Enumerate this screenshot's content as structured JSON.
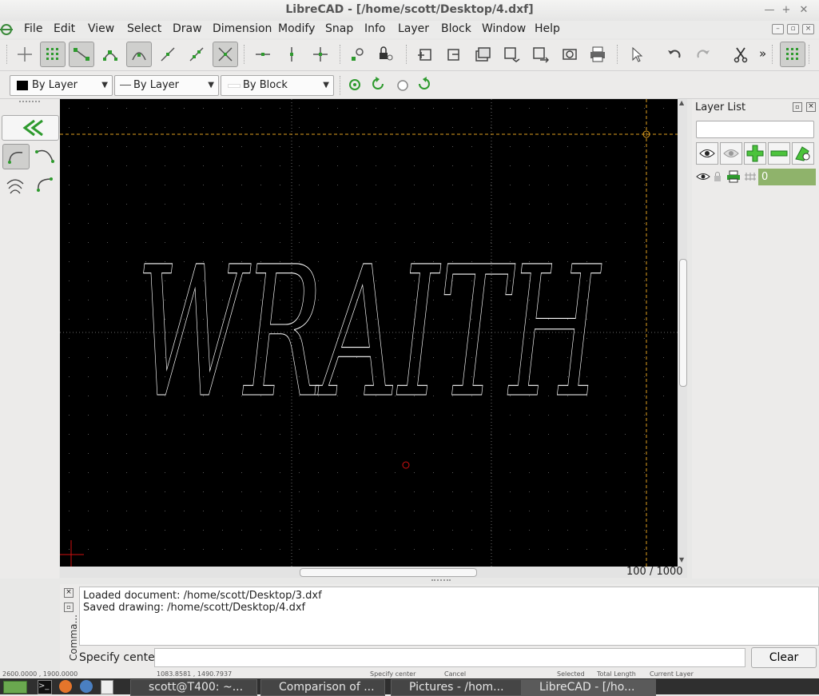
{
  "window": {
    "title": "LibreCAD - [/home/scott/Desktop/4.dxf]"
  },
  "menu": {
    "items": [
      "File",
      "Edit",
      "View",
      "Select",
      "Draw",
      "Dimension",
      "Modify",
      "Snap",
      "Info",
      "Layer",
      "Block",
      "Window",
      "Help"
    ]
  },
  "toolbar": {
    "more_label": "»"
  },
  "pen": {
    "color": "By Layer",
    "linetype": "By Layer",
    "width": "By Block"
  },
  "drawing": {
    "text": "WRAITH",
    "grid_label": "100 / 1000",
    "colors": {
      "background": "#000000",
      "outline": "#ffffff",
      "guide": "#e0a020",
      "origin": "#d01010"
    }
  },
  "layers": {
    "title": "Layer List",
    "filter_placeholder": "",
    "items": [
      {
        "name": "0"
      }
    ]
  },
  "command": {
    "side_label": "Comma...",
    "history": [
      "Loaded document: /home/scott/Desktop/3.dxf",
      "Saved drawing: /home/scott/Desktop/4.dxf"
    ],
    "prompt": "Specify center",
    "clear_label": "Clear"
  },
  "status": {
    "abs_coord": "2600.0000 , 1900.0000",
    "rel_coord": "1083.8581 , 1490.7937",
    "left_action": "Specify center",
    "right_action": "Cancel",
    "selected": "Selected",
    "total_length": "Total Length",
    "current_layer": "Current Layer"
  },
  "taskbar": {
    "tasks": [
      "scott@T400: ~...",
      "Comparison of ...",
      "Pictures - /hom...",
      "LibreCAD - [/ho..."
    ]
  }
}
